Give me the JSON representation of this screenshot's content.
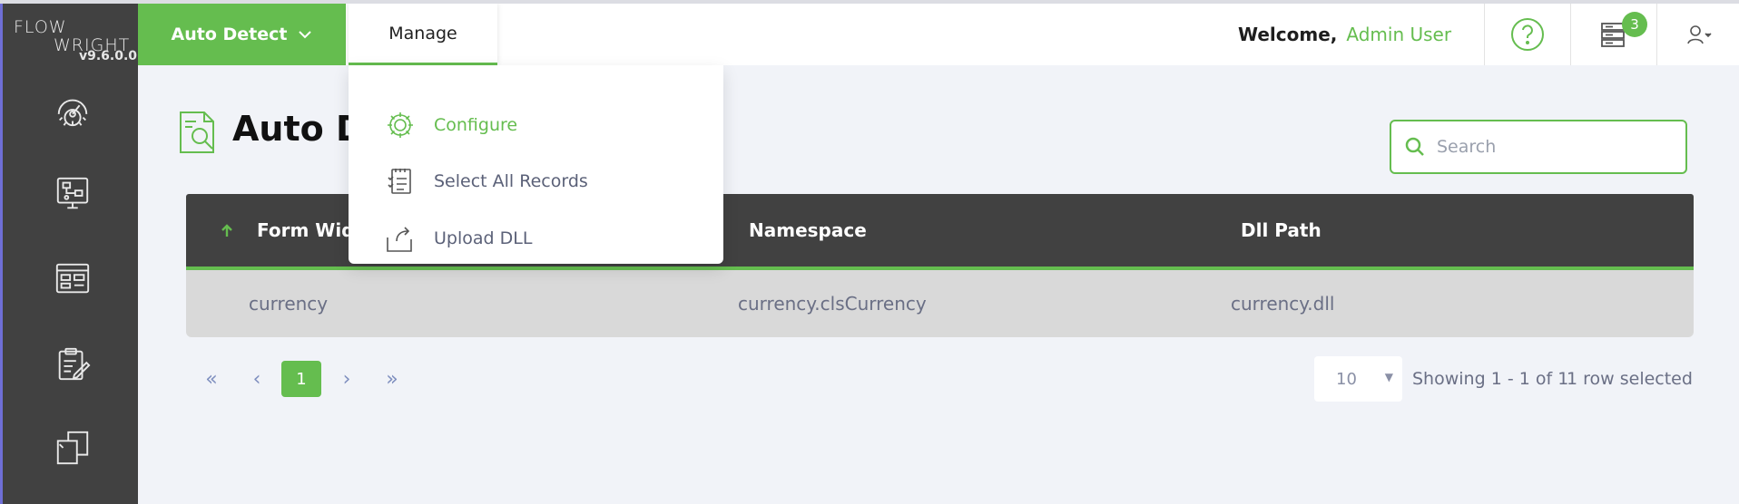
{
  "logo": {
    "line1": "FLOW",
    "line2": "WRIGHT",
    "version": "v9.6.0.0"
  },
  "sidebar": {
    "items": [
      {
        "icon": "dashboard-gear-icon"
      },
      {
        "icon": "monitor-workflow-icon"
      },
      {
        "icon": "form-layout-icon"
      },
      {
        "icon": "clipboard-edit-icon"
      },
      {
        "icon": "documents-icon"
      }
    ]
  },
  "header": {
    "app_button": "Auto Detect",
    "manage_tab": "Manage",
    "welcome_label": "Welcome,",
    "user_name": "Admin User",
    "notification_count": "3"
  },
  "dropdown": {
    "items": [
      {
        "label": "Configure",
        "icon": "gear-icon",
        "active": true
      },
      {
        "label": "Select All Records",
        "icon": "checklist-icon",
        "active": false
      },
      {
        "label": "Upload DLL",
        "icon": "upload-icon",
        "active": false
      }
    ]
  },
  "page": {
    "title": "Auto De"
  },
  "search": {
    "placeholder": "Search"
  },
  "table": {
    "columns": [
      "Form Widg",
      "Namespace",
      "Dll Path"
    ],
    "rows": [
      [
        "currency",
        "currency.clsCurrency",
        "currency.dll"
      ]
    ]
  },
  "pagination": {
    "first": "«",
    "prev": "‹",
    "current": "1",
    "next": "›",
    "last": "»",
    "per_page": "10",
    "showing": "Showing 1 - 1 of 1",
    "selected": "1 row selected"
  },
  "colors": {
    "accent": "#65bd4f",
    "sidebar": "#414141",
    "table_header": "#414141"
  }
}
